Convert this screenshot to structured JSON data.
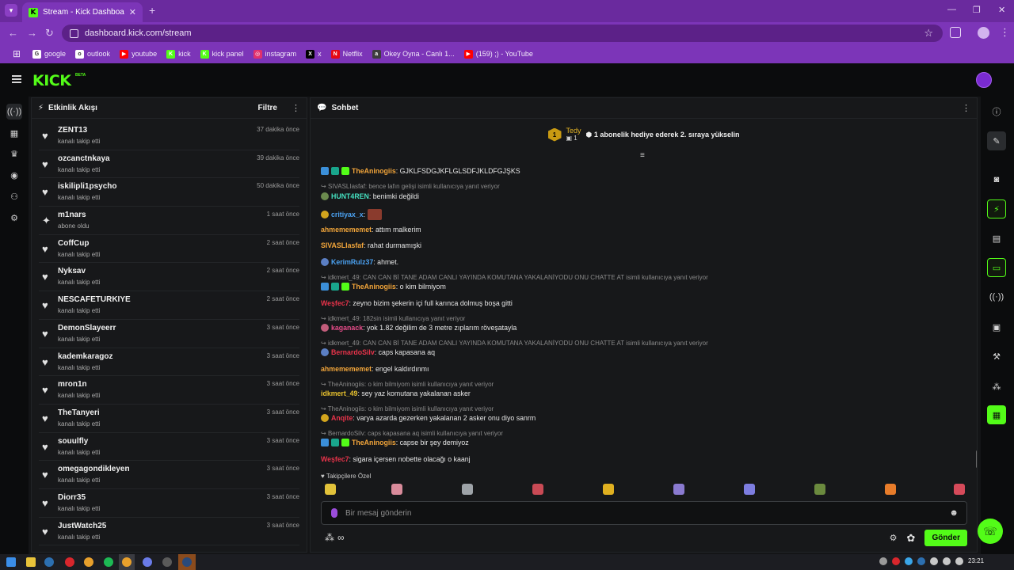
{
  "browser": {
    "tab_title": "Stream - Kick Dashboard",
    "tab_close": "✕",
    "new_tab": "+",
    "url": "dashboard.kick.com/stream",
    "bookmarks": [
      {
        "label": "google",
        "color": "#ffffff",
        "glyph": "G"
      },
      {
        "label": "outlook",
        "color": "#ffffff",
        "glyph": "o"
      },
      {
        "label": "youtube",
        "color": "#ff0000",
        "glyph": "▶"
      },
      {
        "label": "kick",
        "color": "#53fc18",
        "glyph": "K"
      },
      {
        "label": "kick panel",
        "color": "#53fc18",
        "glyph": "K"
      },
      {
        "label": "instagram",
        "color": "#e1306c",
        "glyph": "◎"
      },
      {
        "label": "x",
        "color": "#000000",
        "glyph": "X"
      },
      {
        "label": "Netflix",
        "color": "#e50914",
        "glyph": "N"
      },
      {
        "label": "Okey Oyna - Canlı 1...",
        "color": "#3d3d3d",
        "glyph": "a"
      },
      {
        "label": "(159) ;) - YouTube",
        "color": "#ff0000",
        "glyph": "▶"
      }
    ]
  },
  "kick": {
    "logo": "KICK",
    "beta": "BETA"
  },
  "activity": {
    "title": "Etkinlik Akışı",
    "filter": "Filtre",
    "items": [
      {
        "name": "ZENT13",
        "action": "kanalı takip etti",
        "time": "37 dakika önce",
        "icon": "♥"
      },
      {
        "name": "ozcanctnkaya",
        "action": "kanalı takip etti",
        "time": "39 dakika önce",
        "icon": "♥"
      },
      {
        "name": "iskilipli1psycho",
        "action": "kanalı takip etti",
        "time": "50 dakika önce",
        "icon": "♥"
      },
      {
        "name": "m1nars",
        "action": "abone oldu",
        "time": "1 saat önce",
        "icon": "✦"
      },
      {
        "name": "CoffCup",
        "action": "kanalı takip etti",
        "time": "2 saat önce",
        "icon": "♥"
      },
      {
        "name": "Nyksav",
        "action": "kanalı takip etti",
        "time": "2 saat önce",
        "icon": "♥"
      },
      {
        "name": "NESCAFETURKIYE",
        "action": "kanalı takip etti",
        "time": "2 saat önce",
        "icon": "♥"
      },
      {
        "name": "DemonSlayeerr",
        "action": "kanalı takip etti",
        "time": "3 saat önce",
        "icon": "♥"
      },
      {
        "name": "kademkaragoz",
        "action": "kanalı takip etti",
        "time": "3 saat önce",
        "icon": "♥"
      },
      {
        "name": "mron1n",
        "action": "kanalı takip etti",
        "time": "3 saat önce",
        "icon": "♥"
      },
      {
        "name": "TheTanyeri",
        "action": "kanalı takip etti",
        "time": "3 saat önce",
        "icon": "♥"
      },
      {
        "name": "souulfly",
        "action": "kanalı takip etti",
        "time": "3 saat önce",
        "icon": "♥"
      },
      {
        "name": "omegagondikleyen",
        "action": "kanalı takip etti",
        "time": "3 saat önce",
        "icon": "♥"
      },
      {
        "name": "Diorr35",
        "action": "kanalı takip etti",
        "time": "3 saat önce",
        "icon": "♥"
      },
      {
        "name": "JustWatch25",
        "action": "kanalı takip etti",
        "time": "3 saat önce",
        "icon": "♥"
      }
    ]
  },
  "chat": {
    "title": "Sohbet",
    "pinned": {
      "rank": "1",
      "user": "Tedy",
      "count": "1",
      "text": "1 abonelik hediye ederek 2. sıraya yükselin"
    },
    "messages": [
      {
        "kind": "msg",
        "badges": [
          "b-blue",
          "b-teal",
          "b-green"
        ],
        "user": "TheAninogiis",
        "color": "u-orange",
        "text": ": GJKLFSDGJKFLGLSDFJKLDFGJŞKS"
      },
      {
        "kind": "reply",
        "text": "SIVASLIasfaf: bence lafın gelişi isimli kullanıcıya yanıt veriyor"
      },
      {
        "kind": "msg",
        "badges": [
          "b-avatar"
        ],
        "user": "HUNT4REN",
        "color": "u-teal",
        "text": ": benimki değildi"
      },
      {
        "kind": "msg",
        "badges": [
          "b-gold"
        ],
        "user": "critiyax_x",
        "color": "u-blue",
        "text": ":",
        "emote": true
      },
      {
        "kind": "msg",
        "badges": [],
        "user": "ahmemememet",
        "color": "u-orange",
        "text": ": attım malkerim"
      },
      {
        "kind": "msg",
        "badges": [],
        "user": "SIVASLIasfaf",
        "color": "u-orange",
        "text": ": rahat durmamışki"
      },
      {
        "kind": "msg",
        "badges": [
          "b-avatar2"
        ],
        "user": "KerimRulz37",
        "color": "u-blue",
        "text": ": ahmet."
      },
      {
        "kind": "reply",
        "text": "idkmert_49: CAN CAN Bİ TANE ADAM CANLI YAYINDA KOMUTANA YAKALANİYODU ONU CHATTE AT isimli kullanıcıya yanıt veriyor"
      },
      {
        "kind": "msg",
        "badges": [
          "b-blue",
          "b-teal",
          "b-green"
        ],
        "user": "TheAninogiis",
        "color": "u-orange",
        "text": ": o kim bilmiyom"
      },
      {
        "kind": "msg",
        "badges": [],
        "user": "Weşfec7",
        "color": "u-red",
        "text": ": zeyno bizim şekerin içi full karınca dolmuş boşa gitti"
      },
      {
        "kind": "reply",
        "text": "idkmert_49: 182sin isimli kullanıcıya yanıt veriyor"
      },
      {
        "kind": "msg",
        "badges": [
          "b-avatar3"
        ],
        "user": "kaganack",
        "color": "u-pink",
        "text": ": yok 1.82 değilim de 3 metre zıplarım röveşatayla"
      },
      {
        "kind": "reply",
        "text": "idkmert_49: CAN CAN Bİ TANE ADAM CANLI YAYINDA KOMUTANA YAKALANİYODU ONU CHATTE AT isimli kullanıcıya yanıt veriyor"
      },
      {
        "kind": "msg",
        "badges": [
          "b-avatar2"
        ],
        "user": "BernardoSilv",
        "color": "u-red",
        "text": ": caps kapasana aq"
      },
      {
        "kind": "msg",
        "badges": [],
        "user": "ahmemememet",
        "color": "u-orange",
        "text": ": engel kaldırdınmı"
      },
      {
        "kind": "reply",
        "text": "TheAninogiis: o kim bilmiyom isimli kullanıcıya yanıt veriyor"
      },
      {
        "kind": "msg",
        "badges": [],
        "user": "idkmert_49",
        "color": "u-yellow",
        "text": ": sey yaz komutana yakalanan asker"
      },
      {
        "kind": "reply",
        "text": "TheAninogiis: o kim bilmiyom isimli kullanıcıya yanıt veriyor"
      },
      {
        "kind": "msg",
        "badges": [
          "b-gold"
        ],
        "user": "Anqite",
        "color": "u-red",
        "text": ": varya azarda gezerken yakalanan 2 asker onu diyo sanrm"
      },
      {
        "kind": "reply",
        "text": "BernardoSilv: caps kapasana aq isimli kullanıcıya yanıt veriyor"
      },
      {
        "kind": "msg",
        "badges": [
          "b-blue",
          "b-teal",
          "b-green"
        ],
        "user": "TheAninogiis",
        "color": "u-orange",
        "text": ": capse bir şey demiyoz"
      },
      {
        "kind": "msg",
        "badges": [],
        "user": "Weşfec7",
        "color": "u-red",
        "text": ": sigara içersen nobette olacağı o kaanj"
      }
    ],
    "emote_section_title": "♥ Takipçilere Özel",
    "emote_colors": [
      "#e2c23a",
      "#d98b9b",
      "#9ea3a8",
      "#c94a55",
      "#e0b020",
      "#8a7ad0",
      "#7d7de0",
      "#6b8a3e",
      "#e87c2a",
      "#d64a5a"
    ],
    "input_placeholder": "Bir mesaj gönderin",
    "send_label": "Gönder"
  },
  "taskbar": {
    "clock": "23:21"
  }
}
